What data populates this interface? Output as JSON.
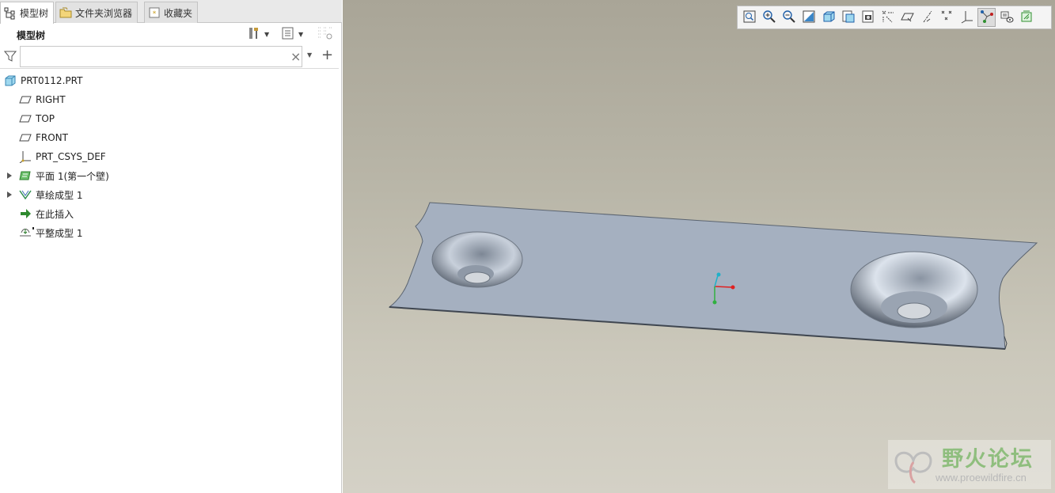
{
  "tabs": [
    {
      "label": "模型树",
      "icon": "model-tree-icon",
      "active": true
    },
    {
      "label": "文件夹浏览器",
      "icon": "folder-browser-icon",
      "active": false
    },
    {
      "label": "收藏夹",
      "icon": "favorites-icon",
      "active": false
    }
  ],
  "tree_header": {
    "title": "模型树",
    "settings_icon": "tools-icon",
    "show_icon": "list-icon",
    "columns_icon": "columns-icon"
  },
  "filter": {
    "value": "",
    "placeholder": "",
    "clear_glyph": "×",
    "add_glyph": "+"
  },
  "tree": {
    "root": {
      "label": "PRT0112.PRT",
      "icon": "part-icon"
    },
    "items": [
      {
        "label": "RIGHT",
        "icon": "datum-plane-icon"
      },
      {
        "label": "TOP",
        "icon": "datum-plane-icon"
      },
      {
        "label": "FRONT",
        "icon": "datum-plane-icon"
      },
      {
        "label": "PRT_CSYS_DEF",
        "icon": "csys-icon"
      },
      {
        "label": "平面 1(第一个壁)",
        "icon": "sheetmetal-wall-icon",
        "expandable": true
      },
      {
        "label": "草绘成型 1",
        "icon": "sketch-form-icon",
        "expandable": true
      },
      {
        "label": "在此插入",
        "icon": "insert-here-icon"
      },
      {
        "label": "平整成型 1",
        "icon": "flatten-form-icon"
      }
    ]
  },
  "view_toolbar": [
    {
      "name": "refit",
      "icon": "refit-icon"
    },
    {
      "name": "zoom-in",
      "icon": "zoom-in-icon"
    },
    {
      "name": "zoom-out",
      "icon": "zoom-out-icon"
    },
    {
      "name": "repaint",
      "icon": "repaint-icon"
    },
    {
      "name": "display-style",
      "icon": "display-style-icon"
    },
    {
      "name": "saved-orientations",
      "icon": "saved-views-icon"
    },
    {
      "name": "view-manager",
      "icon": "view-manager-icon"
    },
    {
      "name": "datum-display-filters",
      "icon": "datum-filters-icon"
    },
    {
      "name": "plane-display",
      "icon": "plane-display-icon"
    },
    {
      "name": "axis-display",
      "icon": "axis-display-icon"
    },
    {
      "name": "point-display",
      "icon": "point-display-icon"
    },
    {
      "name": "csys-display",
      "icon": "csys-display-icon"
    },
    {
      "name": "annotation-display",
      "icon": "annotation-display-icon",
      "pressed": true
    },
    {
      "name": "spin-center",
      "icon": "spin-center-icon"
    },
    {
      "name": "3d-annotations",
      "icon": "annotations-3d-icon"
    }
  ],
  "watermark": {
    "title": "野火论坛",
    "url": "www.proewildfire.cn"
  },
  "colors": {
    "part_face": "#a5b0c0",
    "part_edge": "#5b6470",
    "viewport_top": "#a9a597",
    "viewport_bottom": "#d4d1c6",
    "csys_x": "#e02020",
    "csys_y": "#30b040",
    "csys_z": "#20b0c8"
  }
}
